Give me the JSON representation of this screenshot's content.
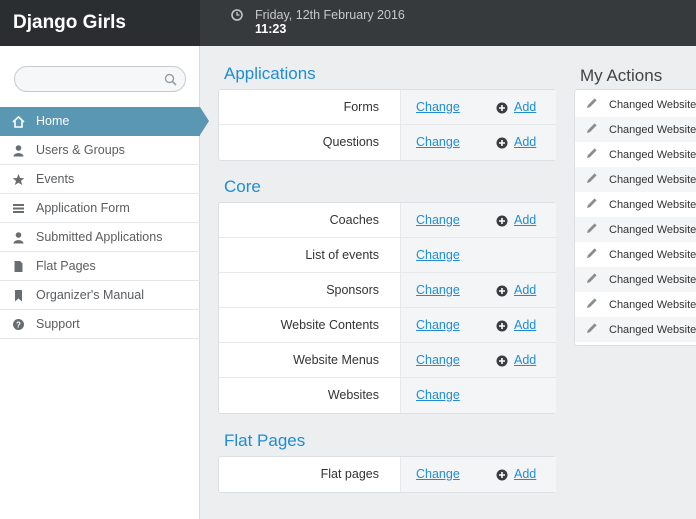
{
  "header": {
    "brand": "Django Girls",
    "date": "Friday, 12th February 2016",
    "time": "11:23"
  },
  "sidebar": {
    "search_placeholder": "",
    "items": [
      {
        "label": "Home",
        "icon": "home-icon",
        "active": true
      },
      {
        "label": "Users & Groups",
        "icon": "user-icon"
      },
      {
        "label": "Events",
        "icon": "star-icon"
      },
      {
        "label": "Application Form",
        "icon": "list-icon"
      },
      {
        "label": "Submitted Applications",
        "icon": "user-icon"
      },
      {
        "label": "Flat Pages",
        "icon": "file-icon"
      },
      {
        "label": "Organizer's Manual",
        "icon": "bookmark-icon"
      },
      {
        "label": "Support",
        "icon": "question-icon"
      }
    ]
  },
  "main": {
    "change_label": "Change",
    "add_label": "Add",
    "sections": [
      {
        "title": "Applications",
        "models": [
          {
            "name": "Forms",
            "add": true
          },
          {
            "name": "Questions",
            "add": true
          }
        ]
      },
      {
        "title": "Core",
        "models": [
          {
            "name": "Coaches",
            "add": true
          },
          {
            "name": "List of events",
            "add": false
          },
          {
            "name": "Sponsors",
            "add": true
          },
          {
            "name": "Website Contents",
            "add": true
          },
          {
            "name": "Website Menus",
            "add": true
          },
          {
            "name": "Websites",
            "add": false
          }
        ]
      },
      {
        "title": "Flat Pages",
        "models": [
          {
            "name": "Flat pages",
            "add": true
          }
        ]
      }
    ]
  },
  "my_actions": {
    "title": "My Actions",
    "items": [
      "Changed Website",
      "Changed Website",
      "Changed Website",
      "Changed Website",
      "Changed Website",
      "Changed Website",
      "Changed Website",
      "Changed Website",
      "Changed Website",
      "Changed Website"
    ]
  },
  "colors": {
    "accent": "#1f8dd6",
    "active_nav": "#5a97b3",
    "header_bg": "#373a3c",
    "brand_bg": "#2b2e30"
  }
}
